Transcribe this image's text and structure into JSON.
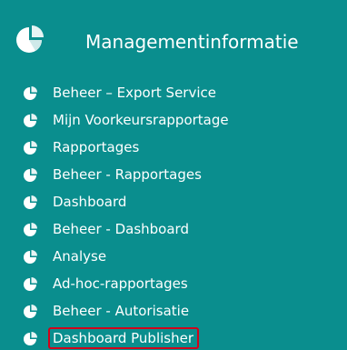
{
  "header": {
    "title": "Managementinformatie",
    "icon": "pie-chart-icon"
  },
  "menu": {
    "items": [
      {
        "label": "Beheer – Export Service",
        "icon": "pie-chart-icon"
      },
      {
        "label": "Mijn Voorkeursrapportage",
        "icon": "pie-chart-icon"
      },
      {
        "label": "Rapportages",
        "icon": "pie-chart-icon"
      },
      {
        "label": "Beheer - Rapportages",
        "icon": "pie-chart-icon"
      },
      {
        "label": "Dashboard",
        "icon": "pie-chart-icon"
      },
      {
        "label": "Beheer - Dashboard",
        "icon": "pie-chart-icon"
      },
      {
        "label": "Analyse",
        "icon": "pie-chart-icon"
      },
      {
        "label": "Ad-hoc-rapportages",
        "icon": "pie-chart-icon"
      },
      {
        "label": "Beheer - Autorisatie",
        "icon": "pie-chart-icon"
      },
      {
        "label": "Dashboard Publisher",
        "icon": "pie-chart-icon",
        "highlighted": true
      }
    ]
  },
  "colors": {
    "panel_background": "#0a8e8e",
    "text": "#ffffff",
    "highlight_border": "#d0021b"
  }
}
